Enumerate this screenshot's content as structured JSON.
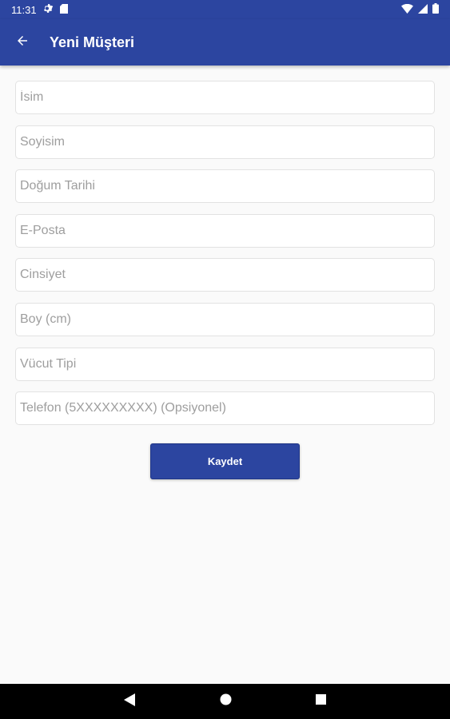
{
  "status_bar": {
    "time": "11:31",
    "icons": [
      "settings-icon",
      "sd-card-icon",
      "wifi-icon",
      "signal-icon",
      "battery-icon"
    ]
  },
  "app_bar": {
    "title": "Yeni Müşteri",
    "back_icon": "arrow-left-icon"
  },
  "form": {
    "fields": [
      {
        "placeholder": "İsim",
        "value": ""
      },
      {
        "placeholder": "Soyisim",
        "value": ""
      },
      {
        "placeholder": "Doğum Tarihi",
        "value": ""
      },
      {
        "placeholder": "E-Posta",
        "value": ""
      },
      {
        "placeholder": "Cinsiyet",
        "value": ""
      },
      {
        "placeholder": "Boy (cm)",
        "value": ""
      },
      {
        "placeholder": "Vücut Tipi",
        "value": ""
      },
      {
        "placeholder": "Telefon (5XXXXXXXXX) (Opsiyonel)",
        "value": ""
      }
    ],
    "save_label": "Kaydet"
  },
  "nav_bar": {
    "icons": [
      "back-triangle-icon",
      "home-circle-icon",
      "recents-square-icon"
    ]
  },
  "colors": {
    "primary": "#2c45a0",
    "background": "#fafafa",
    "placeholder": "#9e9e9e"
  }
}
